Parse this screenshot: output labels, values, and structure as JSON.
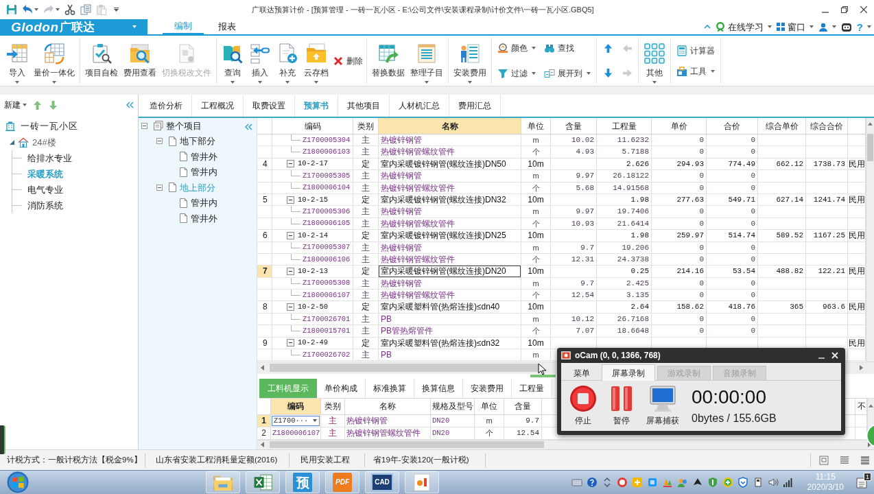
{
  "window": {
    "title": "广联达预算计价 - [预算管理 - 一砖一瓦小区 - E:\\公司文件\\安装课程录制\\计价文件\\一砖一瓦小区.GBQ5]"
  },
  "quick_access": [
    {
      "kind": "save",
      "disabled": false,
      "dropdown": false
    },
    {
      "kind": "undo",
      "disabled": false,
      "dropdown": true
    },
    {
      "kind": "redo",
      "disabled": true,
      "dropdown": true
    },
    {
      "kind": "cut",
      "disabled": false,
      "dropdown": false
    },
    {
      "kind": "copy",
      "disabled": false,
      "dropdown": false
    },
    {
      "kind": "paste",
      "disabled": true,
      "dropdown": false
    }
  ],
  "app_menu": {
    "brand": "Glodon",
    "name": "广联达"
  },
  "ribbon_tabs": [
    {
      "label": "编制",
      "selected": true
    },
    {
      "label": "报表",
      "selected": false
    }
  ],
  "header_tools": [
    {
      "kind": "learn",
      "label": "在线学习",
      "dropdown": true
    },
    {
      "kind": "window",
      "label": "窗口",
      "dropdown": true
    },
    {
      "kind": "user",
      "dropdown": true
    },
    {
      "kind": "robot",
      "dropdown": false
    },
    {
      "kind": "help",
      "label": "?",
      "dropdown": true
    }
  ],
  "ribbon": [
    {
      "kind": "row",
      "buttons": [
        {
          "kind": "large",
          "label": "导入",
          "dropdown": true,
          "disabled": false
        },
        {
          "kind": "large",
          "label": "量价一体化",
          "dropdown": true,
          "disabled": false
        }
      ]
    },
    {
      "kind": "row",
      "buttons": [
        {
          "kind": "large",
          "label": "项目自检",
          "dropdown": false,
          "disabled": false
        },
        {
          "kind": "large",
          "label": "费用查看",
          "dropdown": false,
          "disabled": false
        },
        {
          "kind": "large",
          "label": "切换税改文件",
          "dropdown": false,
          "disabled": true
        }
      ]
    },
    {
      "kind": "row",
      "buttons": [
        {
          "kind": "large",
          "label": "查询",
          "dropdown": true,
          "disabled": false
        },
        {
          "kind": "large",
          "label": "插入",
          "dropdown": true,
          "disabled": false
        },
        {
          "kind": "large",
          "label": "补充",
          "dropdown": true,
          "disabled": false
        },
        {
          "kind": "large",
          "label": "云存档",
          "dropdown": true,
          "disabled": false
        },
        {
          "kind": "small",
          "label": "删除",
          "dropdown": false,
          "disabled": false
        }
      ]
    },
    {
      "kind": "row",
      "buttons": [
        {
          "kind": "large",
          "label": "替换数据",
          "dropdown": false,
          "disabled": false
        },
        {
          "kind": "large",
          "label": "整理子目",
          "dropdown": true,
          "disabled": false
        }
      ]
    },
    {
      "kind": "row",
      "buttons": [
        {
          "kind": "large",
          "label": "安装费用",
          "dropdown": true,
          "disabled": false
        }
      ]
    },
    {
      "kind": "grid",
      "buttons": [
        {
          "kind": "small",
          "label": "颜色",
          "dropdown": true,
          "disabled": false
        },
        {
          "kind": "small",
          "label": "查找",
          "dropdown": false,
          "disabled": false
        },
        {
          "kind": "small",
          "label": "过滤",
          "dropdown": true,
          "disabled": false
        },
        {
          "kind": "small",
          "label": "展开到",
          "dropdown": true,
          "disabled": false
        }
      ]
    },
    {
      "kind": "grid",
      "buttons": [
        {
          "kind": "arrow",
          "disabled": false
        },
        {
          "kind": "arrow",
          "disabled": true
        },
        {
          "kind": "arrow",
          "disabled": false
        },
        {
          "kind": "arrow",
          "disabled": true
        }
      ]
    },
    {
      "kind": "row",
      "buttons": [
        {
          "kind": "large",
          "label": "其他",
          "dropdown": true,
          "disabled": false
        }
      ]
    },
    {
      "kind": "column",
      "buttons": [
        {
          "kind": "small",
          "label": "计算器",
          "dropdown": false,
          "disabled": false
        },
        {
          "kind": "small",
          "label": "工具",
          "dropdown": true,
          "disabled": false
        }
      ]
    }
  ],
  "project_panel": {
    "new_label": "新建",
    "tree": [
      {
        "label": "一砖一瓦小区",
        "selected": false,
        "children": [
          {
            "label": "24#楼",
            "selected": false,
            "expanded": true,
            "children": [
              {
                "label": "给排水专业",
                "selected": false
              },
              {
                "label": "采暖系统",
                "selected": true
              },
              {
                "label": "电气专业",
                "selected": false
              },
              {
                "label": "消防系统",
                "selected": false
              }
            ]
          }
        ]
      }
    ]
  },
  "view_tabs": [
    {
      "label": "造价分析",
      "selected": false
    },
    {
      "label": "工程概况",
      "selected": false
    },
    {
      "label": "取费设置",
      "selected": false
    },
    {
      "label": "预算书",
      "selected": true
    },
    {
      "label": "其他项目",
      "selected": false
    },
    {
      "label": "人材机汇总",
      "selected": false
    },
    {
      "label": "费用汇总",
      "selected": false
    }
  ],
  "section_tree": [
    {
      "label": "整个项目",
      "selected": false,
      "expanded": true,
      "children": [
        {
          "label": "地下部分",
          "selected": false,
          "expanded": true,
          "children": [
            {
              "label": "管井外",
              "selected": false
            },
            {
              "label": "管井内",
              "selected": false
            }
          ]
        },
        {
          "label": "地上部分",
          "selected": true,
          "expanded": true,
          "children": [
            {
              "label": "管井内",
              "selected": false
            },
            {
              "label": "管井外",
              "selected": false
            }
          ]
        }
      ]
    }
  ],
  "table": {
    "columns": [
      {
        "label": "编码",
        "selected": false
      },
      {
        "label": "类别",
        "selected": false
      },
      {
        "label": "名称",
        "selected": true
      },
      {
        "label": "单位",
        "selected": false
      },
      {
        "label": "含量",
        "selected": false
      },
      {
        "label": "工程量",
        "selected": false
      },
      {
        "label": "单价",
        "selected": false
      },
      {
        "label": "合价",
        "selected": false
      },
      {
        "label": "综合单价",
        "selected": false
      },
      {
        "label": "综合合价",
        "selected": false
      },
      {
        "selected": false
      }
    ],
    "rows": [
      {
        "kind": "material",
        "selected": false,
        "code": "Z1700005304",
        "type": "主",
        "name": "热镀锌钢管",
        "unit": "m",
        "content": "10.02",
        "quantity": "11.6232",
        "price": "0",
        "amount": "0"
      },
      {
        "kind": "material",
        "selected": false,
        "code": "Z1800006103",
        "type": "主",
        "name": "热镀锌钢管螺纹管件",
        "unit": "个",
        "content": "4.93",
        "quantity": "5.7188",
        "price": "0",
        "amount": "0"
      },
      {
        "kind": "item",
        "selected": false,
        "expanded": true,
        "no": "4",
        "code": "10-2-17",
        "type": "定",
        "name": "室内采暖镀锌钢管(螺纹连接)DN50",
        "unit": "10m",
        "quantity": "2.626",
        "price": "294.93",
        "amount": "774.49",
        "comp_price": "662.12",
        "comp_amount": "1738.73",
        "column_12": "民用"
      },
      {
        "kind": "material",
        "selected": false,
        "code": "Z1700005305",
        "type": "主",
        "name": "热镀锌钢管",
        "unit": "m",
        "content": "9.97",
        "quantity": "26.18122",
        "price": "0",
        "amount": "0"
      },
      {
        "kind": "material",
        "selected": false,
        "code": "Z1800006104",
        "type": "主",
        "name": "热镀锌钢管螺纹管件",
        "unit": "个",
        "content": "5.68",
        "quantity": "14.91568",
        "price": "0",
        "amount": "0"
      },
      {
        "kind": "item",
        "selected": false,
        "expanded": true,
        "no": "5",
        "code": "10-2-15",
        "type": "定",
        "name": "室内采暖镀锌钢管(螺纹连接)DN32",
        "unit": "10m",
        "quantity": "1.98",
        "price": "277.63",
        "amount": "549.71",
        "comp_price": "627.14",
        "comp_amount": "1241.74",
        "column_12": "民用"
      },
      {
        "kind": "material",
        "selected": false,
        "code": "Z1700005306",
        "type": "主",
        "name": "热镀锌钢管",
        "unit": "m",
        "content": "9.97",
        "quantity": "19.7406",
        "price": "0",
        "amount": "0"
      },
      {
        "kind": "material",
        "selected": false,
        "code": "Z1800006105",
        "type": "主",
        "name": "热镀锌钢管螺纹管件",
        "unit": "个",
        "content": "10.93",
        "quantity": "21.6414",
        "price": "0",
        "amount": "0"
      },
      {
        "kind": "item",
        "selected": false,
        "expanded": true,
        "no": "6",
        "code": "10-2-14",
        "type": "定",
        "name": "室内采暖镀锌钢管(螺纹连接)DN25",
        "unit": "10m",
        "quantity": "1.98",
        "price": "259.97",
        "amount": "514.74",
        "comp_price": "589.52",
        "comp_amount": "1167.25",
        "column_12": "民用"
      },
      {
        "kind": "material",
        "selected": false,
        "code": "Z1700005307",
        "type": "主",
        "name": "热镀锌钢管",
        "unit": "m",
        "content": "9.7",
        "quantity": "19.206",
        "price": "0",
        "amount": "0"
      },
      {
        "kind": "material",
        "selected": false,
        "code": "Z1800006106",
        "type": "主",
        "name": "热镀锌钢管螺纹管件",
        "unit": "个",
        "content": "12.31",
        "quantity": "24.3738",
        "price": "0",
        "amount": "0"
      },
      {
        "kind": "item",
        "selected": true,
        "expanded": true,
        "no": "7",
        "code": "10-2-13",
        "type": "定",
        "name": "室内采暖镀锌钢管(螺纹连接)DN20",
        "unit": "10m",
        "quantity": "0.25",
        "price": "214.16",
        "amount": "53.54",
        "comp_price": "488.82",
        "comp_amount": "122.21",
        "column_12": "民用"
      },
      {
        "kind": "material",
        "selected": false,
        "code": "Z1700005308",
        "type": "主",
        "name": "热镀锌钢管",
        "unit": "m",
        "content": "9.7",
        "quantity": "2.425",
        "price": "0",
        "amount": "0"
      },
      {
        "kind": "material",
        "selected": false,
        "code": "Z1800006107",
        "type": "主",
        "name": "热镀锌钢管螺纹管件",
        "unit": "个",
        "content": "12.54",
        "quantity": "3.135",
        "price": "0",
        "amount": "0"
      },
      {
        "kind": "item",
        "selected": false,
        "expanded": true,
        "no": "8",
        "code": "10-2-50",
        "type": "定",
        "name": "室内采暖塑料管(热熔连接)≤dn40",
        "unit": "10m",
        "quantity": "2.64",
        "price": "158.62",
        "amount": "418.76",
        "comp_price": "365",
        "comp_amount": "963.6",
        "column_12": "民用"
      },
      {
        "kind": "material",
        "selected": false,
        "code": "Z1700026701",
        "type": "主",
        "name": "PB",
        "unit": "m",
        "content": "10.12",
        "quantity": "26.7168",
        "price": "0",
        "amount": "0"
      },
      {
        "kind": "material",
        "selected": false,
        "code": "Z1800015701",
        "type": "主",
        "name": "PB管热熔管件",
        "unit": "个",
        "content": "7.07",
        "quantity": "18.6648",
        "price": "0",
        "amount": "0"
      },
      {
        "kind": "item",
        "selected": false,
        "expanded": true,
        "no": "9",
        "code": "10-2-49",
        "type": "定",
        "name": "室内采暖塑料管(热熔连接)≤dn32",
        "unit": "10m",
        "column_12": "民用"
      },
      {
        "kind": "material",
        "selected": false,
        "code": "Z1700026702",
        "type": "主",
        "name": "PB",
        "unit": "m"
      }
    ]
  },
  "detail_tabs": [
    {
      "label": "工料机显示",
      "selected": true
    },
    {
      "label": "单价构成",
      "selected": false
    },
    {
      "label": "标准换算",
      "selected": false
    },
    {
      "label": "换算信息",
      "selected": false
    },
    {
      "label": "安装费用",
      "selected": false
    },
    {
      "label": "工程量",
      "selected": false
    }
  ],
  "detail_table": {
    "columns": [
      {
        "label": "编码",
        "selected": true
      },
      {
        "label": "类别",
        "selected": false
      },
      {
        "label": "名称",
        "selected": false
      },
      {
        "label": "规格及型号",
        "selected": false
      },
      {
        "label": "单位",
        "selected": false
      },
      {
        "label": "含量",
        "selected": false
      },
      {
        "label": "不",
        "selected": false
      }
    ],
    "rows": [
      {
        "no": "1",
        "selected": true,
        "editing": true,
        "code": "Z1700···",
        "type": "主",
        "name": "热镀锌钢管",
        "spec": "DN20",
        "unit": "m",
        "content": "9.7"
      },
      {
        "no": "2",
        "selected": false,
        "editing": false,
        "code": "Z1800006107",
        "type": "主",
        "name": "热镀锌钢管螺纹管件",
        "spec": "DN20",
        "unit": "个",
        "content": "12.54"
      }
    ]
  },
  "status_bar": {
    "items": [
      "计税方式：一般计税方法【税金9%】",
      "山东省安装工程消耗量定额(2016)",
      "民用安装工程",
      "省19年-安装120(一般计税)"
    ]
  },
  "taskbar": {
    "apps": [
      {
        "kind": "folder"
      },
      {
        "kind": "spreadsheet"
      },
      {
        "kind": "tile",
        "label": "预"
      },
      {
        "kind": "pdf",
        "label": "PDF"
      },
      {
        "kind": "cad",
        "label": "CAD"
      },
      {
        "kind": "slides"
      }
    ],
    "time": "11:15",
    "date": "2020/3/10",
    "notification_count": "1"
  },
  "recorder": {
    "title": "oCam (0, 0, 1366, 768)",
    "tabs": [
      {
        "label": "菜单",
        "selected": false,
        "disabled": false
      },
      {
        "label": "屏幕录制",
        "selected": true,
        "disabled": false
      },
      {
        "label": "游戏录制",
        "selected": false,
        "disabled": true
      },
      {
        "label": "音频录制",
        "selected": false,
        "disabled": true
      }
    ],
    "buttons": [
      {
        "kind": "stop",
        "label": "停止"
      },
      {
        "kind": "pause",
        "label": "暂停"
      },
      {
        "kind": "capture",
        "label": "屏幕捕获"
      }
    ],
    "elapsed": "00:00:00",
    "storage": "0bytes / 155.6GB"
  }
}
